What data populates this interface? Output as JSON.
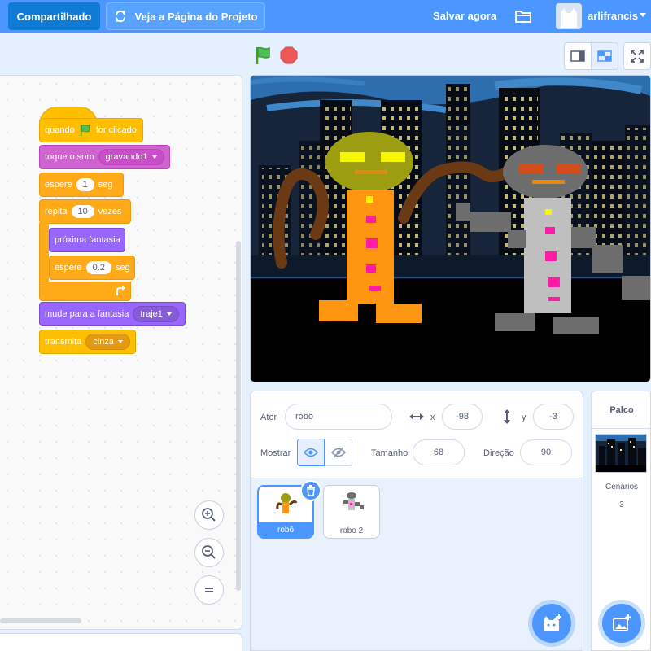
{
  "menu": {
    "share_label": "Compartilhado",
    "see_project_label": "Veja a Página do Projeto",
    "save_label": "Salvar agora",
    "username": "arlifrancis"
  },
  "blocks": {
    "hat_when": "quando",
    "hat_clicked": "for clicado",
    "play_sound": "toque o som",
    "sound_value": "gravando1",
    "wait1_label": "espere",
    "wait1_value": "1",
    "wait1_unit": "seg",
    "repeat_label": "repita",
    "repeat_value": "10",
    "repeat_unit": "vezes",
    "next_costume": "próxima fantasia",
    "wait2_label": "espere",
    "wait2_value": "0.2",
    "wait2_unit": "seg",
    "switch_costume": "mude para a fantasia",
    "costume_value": "traje1",
    "broadcast": "transmita",
    "broadcast_value": "cinza"
  },
  "sprite_info": {
    "sprite_label": "Ator",
    "sprite_name": "robô",
    "x_label": "x",
    "x_value": "-98",
    "y_label": "y",
    "y_value": "-3",
    "show_label": "Mostrar",
    "size_label": "Tamanho",
    "size_value": "68",
    "direction_label": "Direção",
    "direction_value": "90"
  },
  "sprites": [
    {
      "name": "robô",
      "selected": true
    },
    {
      "name": "robo 2",
      "selected": false
    }
  ],
  "stage_panel": {
    "title": "Palco",
    "backdrops_label": "Cenários",
    "backdrops_count": "3"
  },
  "colors": {
    "menu_blue": "#4c97ff",
    "events": "#ffbf00",
    "sound": "#cf63cf",
    "control": "#ffab19",
    "looks": "#9966ff"
  }
}
